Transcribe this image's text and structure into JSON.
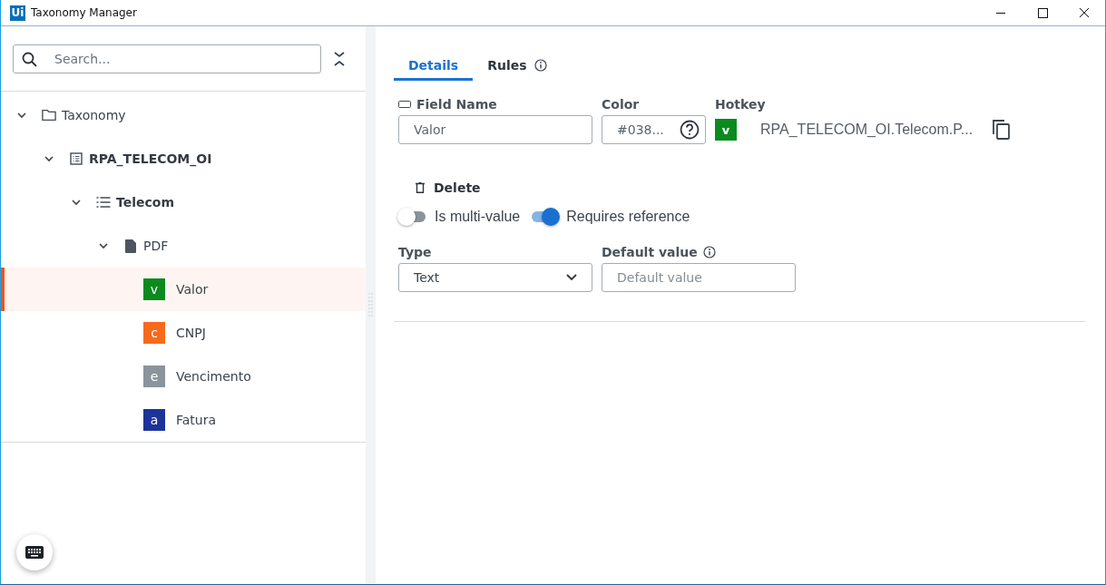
{
  "window": {
    "logo": "Ui",
    "title": "Taxonomy Manager"
  },
  "search": {
    "placeholder": "Search..."
  },
  "tree": [
    {
      "kind": "folder",
      "label": "Taxonomy",
      "expanded": true,
      "selected": false,
      "children": [
        {
          "kind": "document-type",
          "label": "RPA_TELECOM_OI",
          "expanded": true,
          "selected": false,
          "children": [
            {
              "kind": "group",
              "label": "Telecom",
              "expanded": true,
              "selected": false,
              "children": [
                {
                  "kind": "file",
                  "label": "PDF",
                  "expanded": true,
                  "selected": false,
                  "children": [
                    {
                      "kind": "field",
                      "label": "Valor",
                      "letter": "v",
                      "color": "#0b8a1e",
                      "selected": true
                    },
                    {
                      "kind": "field",
                      "label": "CNPJ",
                      "letter": "c",
                      "color": "#f76a1c",
                      "selected": false
                    },
                    {
                      "kind": "field",
                      "label": "Vencimento",
                      "letter": "e",
                      "color": "#8a949c",
                      "selected": false
                    },
                    {
                      "kind": "field",
                      "label": "Fatura",
                      "letter": "a",
                      "color": "#1e3399",
                      "selected": false
                    }
                  ]
                }
              ]
            }
          ]
        }
      ]
    }
  ],
  "tabs": [
    {
      "label": "Details",
      "selected": true,
      "info": false
    },
    {
      "label": "Rules",
      "selected": false,
      "info": true
    }
  ],
  "details": {
    "field_name": {
      "label": "Field Name",
      "value": "Valor"
    },
    "color": {
      "label": "Color",
      "value": "#038..."
    },
    "hotkey": {
      "label": "Hotkey",
      "letter": "v",
      "color": "#0b8a1e"
    },
    "path": "RPA_TELECOM_OI.Telecom.P...",
    "delete": "Delete",
    "toggles": [
      {
        "label": "Is multi-value",
        "on": false
      },
      {
        "label": "Requires reference",
        "on": true
      }
    ],
    "type": {
      "label": "Type",
      "value": "Text"
    },
    "default_value": {
      "label": "Default value",
      "placeholder": "Default value"
    }
  }
}
